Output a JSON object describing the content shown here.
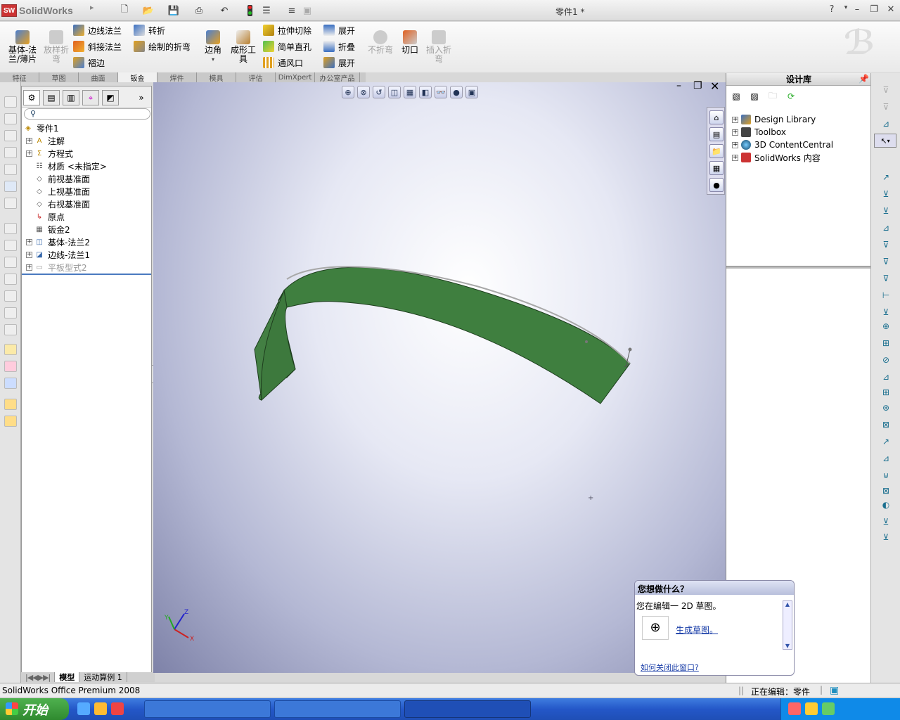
{
  "app": {
    "name": "SolidWorks",
    "doc_title": "零件1 *"
  },
  "window_controls": {
    "help": "?",
    "minimize": "–",
    "restore": "❐",
    "close": "✕"
  },
  "ribbon": {
    "base_flange": "基体-法\n兰/薄片",
    "lofted_bend": "放样折\n弯",
    "edge_flange": "边线法兰",
    "miter_flange": "斜接法兰",
    "hem": "褶边",
    "jog": "转折",
    "sketched_bend": "绘制的折弯",
    "corner": "边角",
    "forming_tool": "成形工\n具",
    "extruded_cut": "拉伸切除",
    "simple_hole": "简单直孔",
    "vent": "通风口",
    "unfold": "展开",
    "fold": "折叠",
    "flatten": "展开",
    "no_bends": "不折弯",
    "rip": "切口",
    "insert_bends": "插入折\n弯"
  },
  "command_tabs": [
    "特征",
    "草图",
    "曲面",
    "钣金",
    "焊件",
    "模具",
    "评估",
    "DimXpert",
    "办公室产品"
  ],
  "feature_tree": {
    "root": "零件1",
    "items": [
      {
        "label": "注解",
        "expandable": true
      },
      {
        "label": "方程式",
        "expandable": true
      },
      {
        "label": "材质 <未指定>",
        "expandable": false
      },
      {
        "label": "前视基准面",
        "expandable": false
      },
      {
        "label": "上视基准面",
        "expandable": false
      },
      {
        "label": "右视基准面",
        "expandable": false
      },
      {
        "label": "原点",
        "expandable": false
      },
      {
        "label": "钣金2",
        "expandable": false
      },
      {
        "label": "基体-法兰2",
        "expandable": true
      },
      {
        "label": "边线-法兰1",
        "expandable": true
      },
      {
        "label": "平板型式2",
        "expandable": true
      }
    ]
  },
  "model_tabs": {
    "model": "模型",
    "motion": "运动算例 1"
  },
  "design_library": {
    "title": "设计库",
    "items": [
      "Design Library",
      "Toolbox",
      "3D ContentCentral",
      "SolidWorks 内容"
    ]
  },
  "popup": {
    "title": "您想做什么？",
    "message": "您在编辑一 2D 草图。",
    "action": "生成草图。",
    "close_link": "如何关闭此窗口?"
  },
  "status": {
    "left": "SolidWorks Office Premium 2008",
    "right": "正在编辑：零件"
  },
  "taskbar": {
    "start": "开始"
  },
  "colors": {
    "part_green": "#3f7f3f",
    "accent_blue": "#245edb"
  }
}
